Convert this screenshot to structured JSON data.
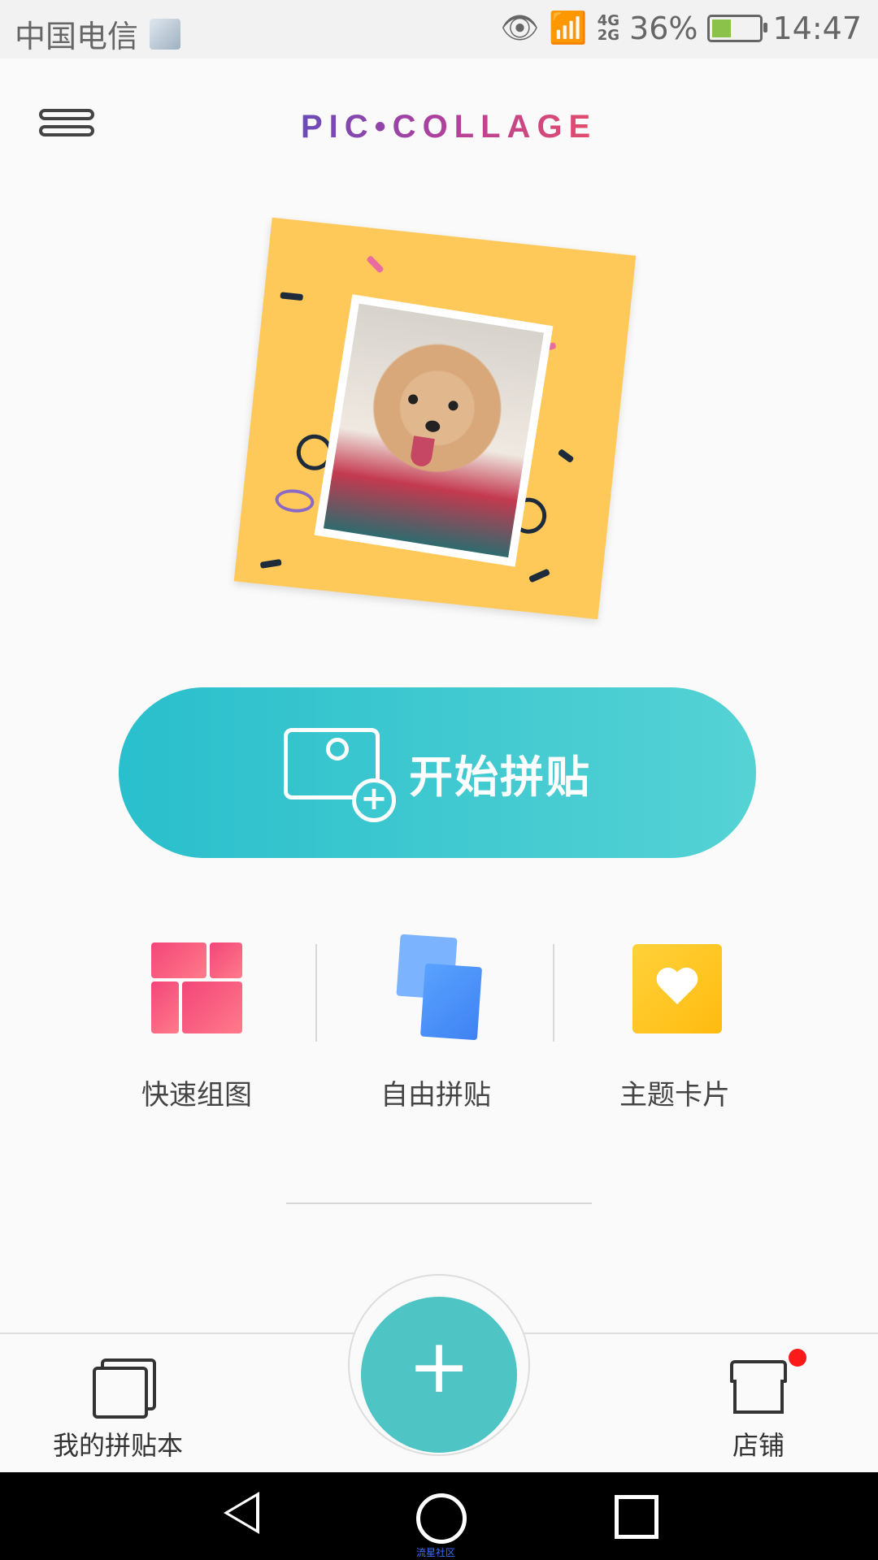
{
  "status_bar": {
    "carrier": "中国电信",
    "network_top": "4G",
    "network_bottom": "2G",
    "battery_percent": "36%",
    "time": "14:47"
  },
  "header": {
    "logo_text": "PIC•COLLAGE",
    "menu_icon": "hamburger-menu-icon"
  },
  "main": {
    "start_button_label": "开始拼贴",
    "tools": [
      {
        "label": "快速组图",
        "icon": "grid-layout-icon"
      },
      {
        "label": "自由拼贴",
        "icon": "stacked-photos-icon"
      },
      {
        "label": "主题卡片",
        "icon": "heart-card-icon"
      }
    ]
  },
  "bottom_nav": {
    "left_label": "我的拼贴本",
    "right_label": "店铺",
    "center_icon": "plus-icon",
    "store_badge_color": "#ff1a1a"
  },
  "system_nav": {
    "watermark": "流星社区"
  },
  "colors": {
    "accent": "#4ec4c4",
    "start_button_gradient": [
      "#29bfcc",
      "#55d2d4"
    ],
    "quick_icon": "#f2467a",
    "free_icon": "#5aa2ff",
    "theme_icon": "#ffc21a"
  }
}
